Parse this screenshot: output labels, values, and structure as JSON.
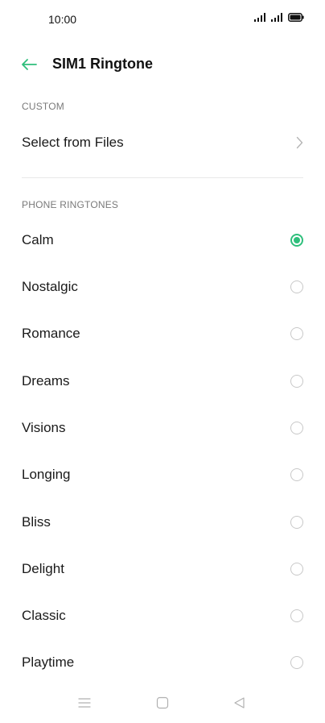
{
  "status_bar": {
    "time": "10:00"
  },
  "app_bar": {
    "title": "SIM1 Ringtone",
    "back_icon": "arrow-left-icon"
  },
  "custom_section": {
    "header": "CUSTOM",
    "select_from_files_label": "Select from Files"
  },
  "ringtones_section": {
    "header": "PHONE RINGTONES",
    "items": [
      {
        "label": "Calm",
        "selected": true
      },
      {
        "label": "Nostalgic",
        "selected": false
      },
      {
        "label": "Romance",
        "selected": false
      },
      {
        "label": "Dreams",
        "selected": false
      },
      {
        "label": "Visions",
        "selected": false
      },
      {
        "label": "Longing",
        "selected": false
      },
      {
        "label": "Bliss",
        "selected": false
      },
      {
        "label": "Delight",
        "selected": false
      },
      {
        "label": "Classic",
        "selected": false
      },
      {
        "label": "Playtime",
        "selected": false
      }
    ]
  },
  "colors": {
    "accent": "#2fbf7c",
    "text_primary": "#1a1a1a",
    "text_secondary": "#7a7a7a",
    "divider": "#e8e8e8"
  }
}
